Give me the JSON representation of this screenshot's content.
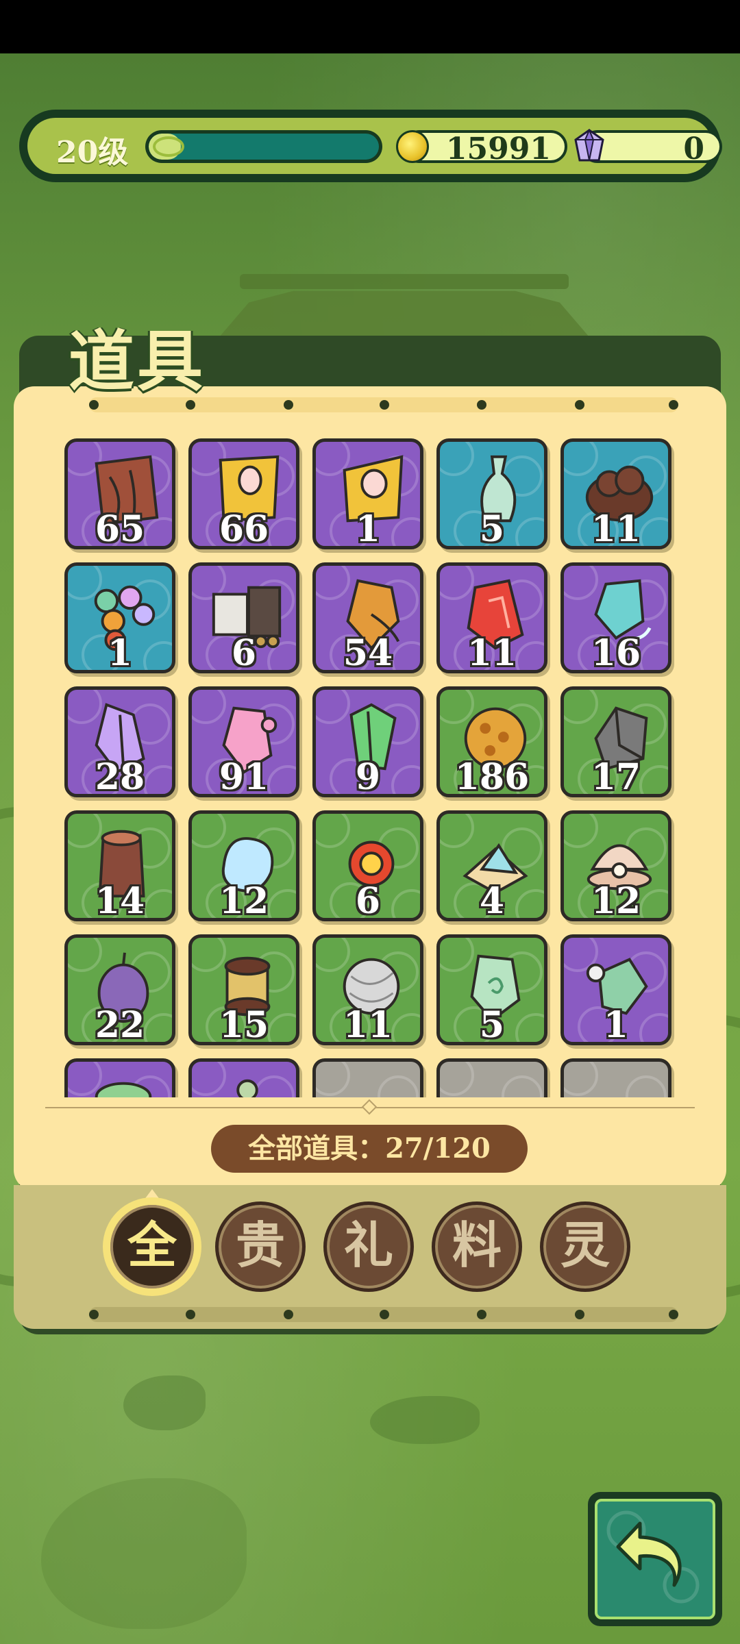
{
  "status": {
    "level": "20级",
    "exp_fraction": 0.14,
    "coins": "15991",
    "gems": "0"
  },
  "panel": {
    "title": "道具",
    "total_label": "全部道具：27/120"
  },
  "items": [
    {
      "count": "65",
      "bg": "purple",
      "icon": "brown-scroll-icon"
    },
    {
      "count": "66",
      "bg": "purple",
      "icon": "gold-talisman-icon"
    },
    {
      "count": "1",
      "bg": "purple",
      "icon": "gold-peach-talisman-icon"
    },
    {
      "count": "5",
      "bg": "blue",
      "icon": "jade-vase-icon"
    },
    {
      "count": "11",
      "bg": "blue",
      "icon": "dark-cloud-stone-icon"
    },
    {
      "count": "1",
      "bg": "blue",
      "icon": "colored-orbs-icon"
    },
    {
      "count": "6",
      "bg": "purple",
      "icon": "painting-scroll-icon"
    },
    {
      "count": "54",
      "bg": "purple",
      "icon": "amber-crystal-icon"
    },
    {
      "count": "11",
      "bg": "purple",
      "icon": "fire-crystal-icon"
    },
    {
      "count": "16",
      "bg": "purple",
      "icon": "water-crystal-icon"
    },
    {
      "count": "28",
      "bg": "purple",
      "icon": "violet-crystal-icon"
    },
    {
      "count": "91",
      "bg": "purple",
      "icon": "pink-crystal-icon"
    },
    {
      "count": "9",
      "bg": "purple",
      "icon": "green-crystal-icon"
    },
    {
      "count": "186",
      "bg": "green",
      "icon": "golden-ore-icon"
    },
    {
      "count": "17",
      "bg": "green",
      "icon": "iron-ore-icon"
    },
    {
      "count": "14",
      "bg": "green",
      "icon": "wood-stump-icon"
    },
    {
      "count": "12",
      "bg": "green",
      "icon": "water-droplet-icon"
    },
    {
      "count": "6",
      "bg": "green",
      "icon": "fire-orb-icon"
    },
    {
      "count": "4",
      "bg": "green",
      "icon": "salt-pile-icon"
    },
    {
      "count": "12",
      "bg": "green",
      "icon": "pearl-shell-icon"
    },
    {
      "count": "22",
      "bg": "green",
      "icon": "grape-fruit-icon"
    },
    {
      "count": "15",
      "bg": "green",
      "icon": "thread-spool-icon"
    },
    {
      "count": "11",
      "bg": "green",
      "icon": "yarn-ball-icon"
    },
    {
      "count": "5",
      "bg": "green",
      "icon": "jade-stone-icon"
    },
    {
      "count": "1",
      "bg": "purple",
      "icon": "jade-crystal-icon"
    },
    {
      "count": "",
      "bg": "purple",
      "icon": "green-plant-icon"
    },
    {
      "count": "",
      "bg": "purple",
      "icon": "spirit-icon"
    },
    {
      "count": "",
      "bg": "empty",
      "icon": ""
    },
    {
      "count": "",
      "bg": "empty",
      "icon": ""
    },
    {
      "count": "",
      "bg": "empty",
      "icon": ""
    }
  ],
  "categories": [
    {
      "label": "全",
      "active": true
    },
    {
      "label": "贵",
      "active": false
    },
    {
      "label": "礼",
      "active": false
    },
    {
      "label": "料",
      "active": false
    },
    {
      "label": "灵",
      "active": false
    }
  ],
  "back_button_icon": "back-arrow-icon"
}
